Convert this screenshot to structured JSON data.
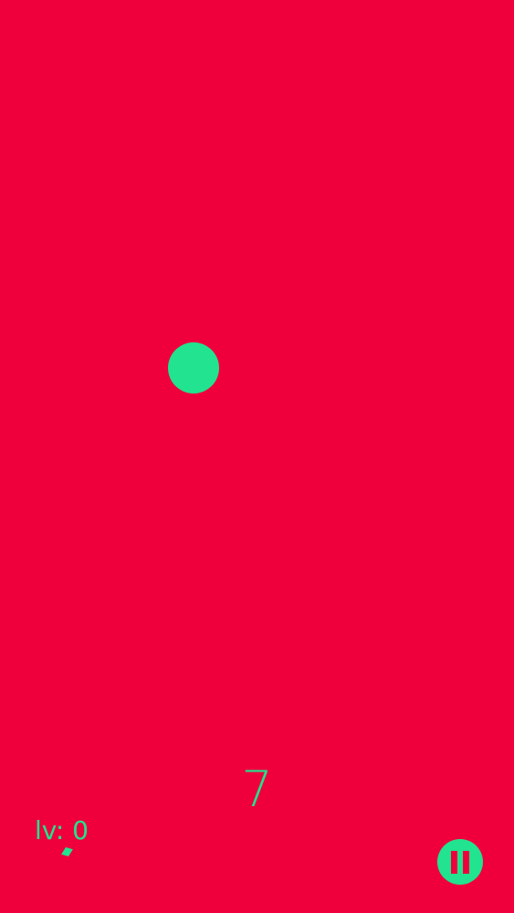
{
  "game": {
    "background_color": "#EF003C",
    "accent_color": "#22E38F",
    "score": "7",
    "level_text": "lv: 0"
  },
  "controls": {
    "pause_icon": "pause-icon"
  }
}
